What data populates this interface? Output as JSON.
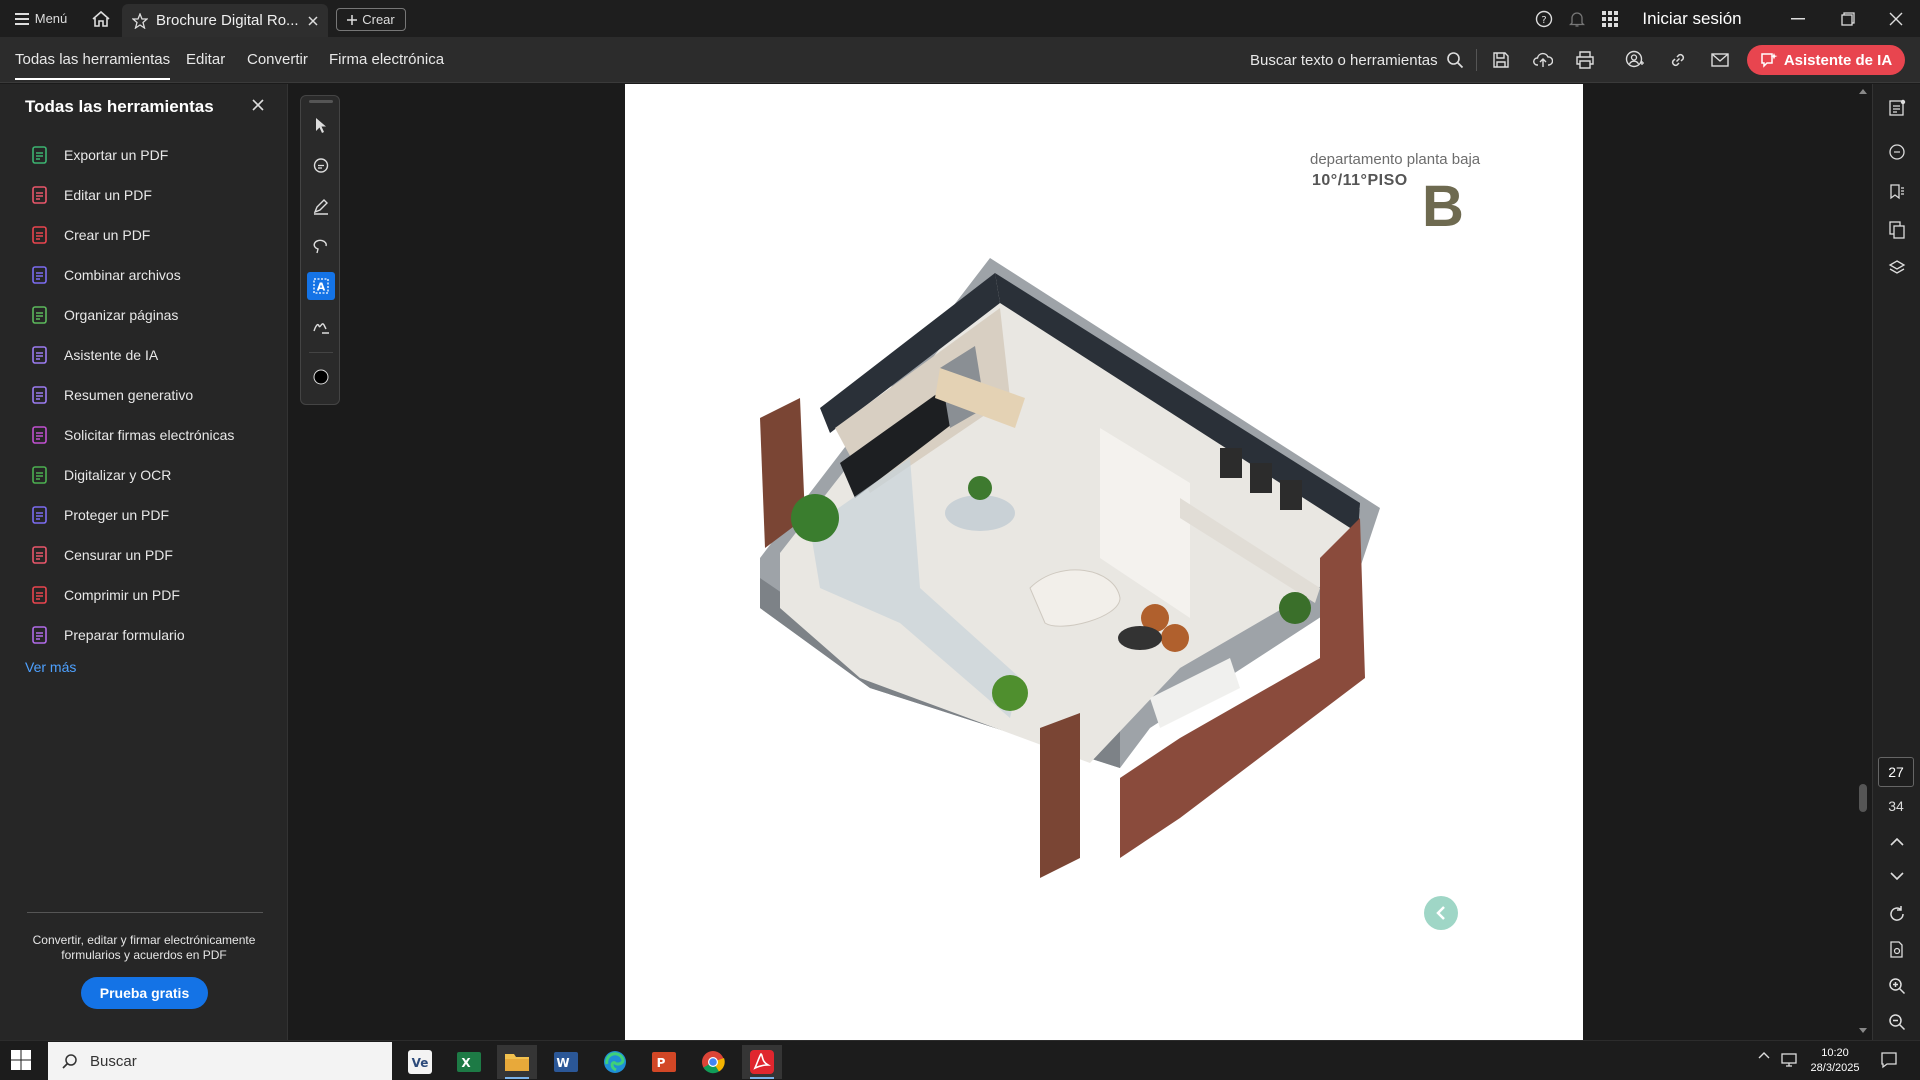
{
  "titlebar": {
    "menu_label": "Menú",
    "tab_title": "Brochure Digital Ro...",
    "create_label": "Crear",
    "login_label": "Iniciar sesión"
  },
  "toolbar": {
    "tabs": [
      {
        "label": "Todas las herramientas",
        "active": true
      },
      {
        "label": "Editar",
        "active": false
      },
      {
        "label": "Convertir",
        "active": false
      },
      {
        "label": "Firma electrónica",
        "active": false
      }
    ],
    "search_label": "Buscar texto o herramientas",
    "ai_button_label": "Asistente de IA",
    "accent_color": "#e8454f"
  },
  "left_panel": {
    "title": "Todas las herramientas",
    "tools": [
      {
        "label": "Exportar un PDF",
        "color": "#3cb371"
      },
      {
        "label": "Editar un PDF",
        "color": "#e8566a"
      },
      {
        "label": "Crear un PDF",
        "color": "#e8454f"
      },
      {
        "label": "Combinar archivos",
        "color": "#7b6cf0"
      },
      {
        "label": "Organizar páginas",
        "color": "#5cb85c"
      },
      {
        "label": "Asistente de IA",
        "color": "#9b7bf0"
      },
      {
        "label": "Resumen generativo",
        "color": "#9b7bf0"
      },
      {
        "label": "Solicitar firmas electrónicas",
        "color": "#c050d0"
      },
      {
        "label": "Digitalizar y OCR",
        "color": "#4caf50"
      },
      {
        "label": "Proteger un PDF",
        "color": "#7b6cf0"
      },
      {
        "label": "Censurar un PDF",
        "color": "#e8566a"
      },
      {
        "label": "Comprimir un PDF",
        "color": "#e8454f"
      },
      {
        "label": "Preparar formulario",
        "color": "#b06be8"
      }
    ],
    "see_more": "Ver más",
    "promo_text": "Convertir, editar y firmar electrónicamente formularios y acuerdos en PDF",
    "trial_button": "Prueba gratis"
  },
  "document": {
    "label_line1": "departamento planta baja",
    "label_line2": "10°/11°PISO",
    "unit_letter": "B"
  },
  "page_nav": {
    "current_page": "27",
    "total_pages": "34"
  },
  "taskbar": {
    "search_placeholder": "Buscar",
    "time": "10:20",
    "date": "28/3/2025"
  }
}
